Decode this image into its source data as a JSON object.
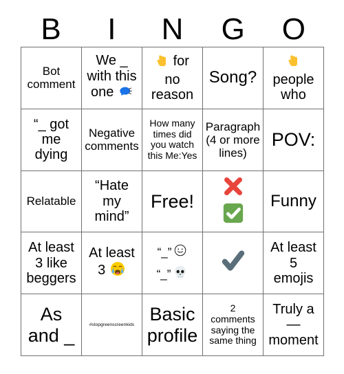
{
  "card": {
    "title_letters": [
      "B",
      "I",
      "N",
      "G",
      "O"
    ],
    "columns": [
      "B",
      "I",
      "N",
      "G",
      "O"
    ],
    "rows": 5,
    "cols": 5,
    "grid_border_color": "#707070",
    "background_color": "#ffffff",
    "text_color": "#000000"
  },
  "cells": [
    {
      "id": "b1",
      "col": "B",
      "row": 1,
      "text": "Bot\ncomment",
      "size": "sz-md",
      "icons": []
    },
    {
      "id": "i1",
      "col": "I",
      "row": 1,
      "text": "We _\nwith this\none ",
      "size": "sz-lg",
      "icons": [
        "speaking-head-icon"
      ]
    },
    {
      "id": "n1",
      "col": "N",
      "row": 1,
      "text": " for\nno\nreason",
      "size": "sz-lg",
      "icons": [
        "pointing-down-icon"
      ]
    },
    {
      "id": "g1",
      "col": "G",
      "row": 1,
      "text": "Song?",
      "size": "sz-xl",
      "icons": []
    },
    {
      "id": "o1",
      "col": "O",
      "row": 1,
      "text": "\npeople\nwho",
      "size": "sz-lg",
      "icons": [
        "pointing-down-icon"
      ]
    },
    {
      "id": "b2",
      "col": "B",
      "row": 2,
      "text": "“_ got\nme\ndying",
      "size": "sz-lg",
      "icons": []
    },
    {
      "id": "i2",
      "col": "I",
      "row": 2,
      "text": "Negative\ncomments",
      "size": "sz-md",
      "icons": []
    },
    {
      "id": "n2",
      "col": "N",
      "row": 2,
      "text": "How many\ntimes did\nyou watch\nthis Me:Yes",
      "size": "sz-sm",
      "icons": []
    },
    {
      "id": "g2",
      "col": "G",
      "row": 2,
      "text": "Paragraph\n(4 or more\nlines)",
      "size": "sz-md",
      "icons": []
    },
    {
      "id": "o2",
      "col": "O",
      "row": 2,
      "text": "POV:",
      "size": "sz-xxl",
      "icons": []
    },
    {
      "id": "b3",
      "col": "B",
      "row": 3,
      "text": "Relatable",
      "size": "sz-md",
      "icons": []
    },
    {
      "id": "i3",
      "col": "I",
      "row": 3,
      "text": "“Hate\nmy\nmind”",
      "size": "sz-lg",
      "icons": []
    },
    {
      "id": "n3",
      "col": "N",
      "row": 3,
      "text": "Free!",
      "size": "sz-xxl",
      "icons": []
    },
    {
      "id": "g3",
      "col": "G",
      "row": 3,
      "text": "",
      "size": "sz-lg",
      "icons": [
        "cross-mark-icon",
        "check-mark-button-icon"
      ]
    },
    {
      "id": "o3",
      "col": "O",
      "row": 3,
      "text": "Funny",
      "size": "sz-xl",
      "icons": []
    },
    {
      "id": "b4",
      "col": "B",
      "row": 4,
      "text": "At least\n3 like\nbeggers",
      "size": "sz-lg",
      "icons": []
    },
    {
      "id": "i4",
      "col": "I",
      "row": 4,
      "text": "At least\n3 ",
      "size": "sz-lg",
      "icons": [
        "loudly-crying-face-icon"
      ]
    },
    {
      "id": "n4",
      "col": "N",
      "row": 4,
      "text": "“_” ☺\n“_” 💀",
      "size": "sz-md",
      "icons": [
        "smiling-face-icon",
        "skull-icon"
      ]
    },
    {
      "id": "g4",
      "col": "G",
      "row": 4,
      "text": "",
      "size": "sz-lg",
      "icons": [
        "heavy-check-mark-icon"
      ]
    },
    {
      "id": "o4",
      "col": "O",
      "row": 4,
      "text": "At least\n5\nemojis",
      "size": "sz-lg",
      "icons": []
    },
    {
      "id": "b5",
      "col": "B",
      "row": 5,
      "text": "As\nand _",
      "size": "sz-xxl",
      "icons": []
    },
    {
      "id": "i5",
      "col": "I",
      "row": 5,
      "text": "#stopgreenscreenkids",
      "size": "sz-tiny",
      "icons": []
    },
    {
      "id": "n5",
      "col": "N",
      "row": 5,
      "text": "Basic\nprofile",
      "size": "sz-xxl",
      "icons": []
    },
    {
      "id": "g5",
      "col": "G",
      "row": 5,
      "text": "2\ncomments\nsaying the\nsame thing",
      "size": "sz-sm",
      "icons": []
    },
    {
      "id": "o5",
      "col": "O",
      "row": 5,
      "text": "Truly a\n—\nmoment",
      "size": "sz-lg",
      "icons": []
    }
  ],
  "colors": {
    "pointing_down_hand": "#FBC02D",
    "speaking_head_blue": "#1A73E8",
    "cross_mark_red": "#E8453C",
    "check_button_green": "#69A74E",
    "heavy_check_gray": "#5A6E7A",
    "crying_face_yellow": "#FCCB00",
    "crying_tear_blue": "#5DADEC",
    "skull_white": "#E8EEF0",
    "grid_line": "#707070"
  }
}
